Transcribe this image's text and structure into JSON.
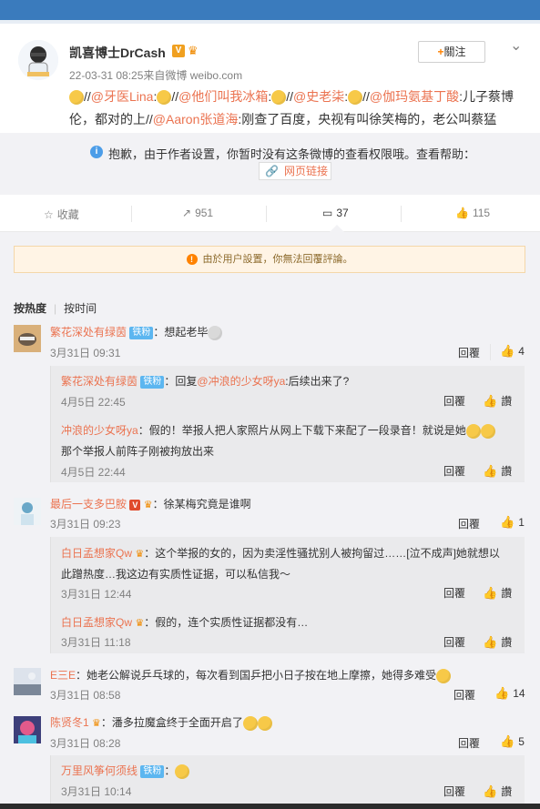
{
  "post": {
    "author": "凯喜博士DrCash",
    "v_badge": "V",
    "date_source": "22-03-31 08:25来自微博 weibo.com",
    "follow_label": "關注",
    "content": {
      "seg1": "//",
      "mention1": "@牙医Lina",
      "seg2": ":",
      "seg3": "//",
      "mention2": "@他们叫我冰箱",
      "seg4": ":",
      "seg5": "//",
      "mention3": "@史老柒",
      "seg6": ":",
      "seg7": "//",
      "mention4": "@伽玛氨基丁酸",
      "seg8": ":儿子蔡博",
      "seg9": "伦，都对的上//",
      "mention5": "@Aaron张道海",
      "seg10": ":刚查了百度，央视有叫徐笑梅的，老公叫蔡猛"
    },
    "notice": "抱歉，由于作者设置，你暂时没有这条微博的查看权限哦。查看帮助：",
    "web_link": "网页链接"
  },
  "actions": {
    "favorite": "收藏",
    "repost": "951",
    "comment": "37",
    "like": "115"
  },
  "comments_area": {
    "warning": "由於用户設置，你無法回覆評論。",
    "sort_hot": "按热度",
    "sort_time": "按时间",
    "reply_label": "回覆",
    "like_label": "讚",
    "fan_badge": "铁粉"
  },
  "comments": [
    {
      "user": "繁花深处有绿茵",
      "text": "想起老毕",
      "time": "3月31日 09:31",
      "likes": "4"
    },
    {
      "user": "最后一支多巴胺",
      "text": "徐某梅究竟是谁啊",
      "time": "3月31日 09:23",
      "likes": "1"
    },
    {
      "user": "E三E",
      "text": "她老公解说乒乓球的，每次看到国乒把小日子按在地上摩擦，她得多难受",
      "time": "3月31日 08:58",
      "likes": "14"
    },
    {
      "user": "陈贤冬1",
      "text": "潘多拉魔盒终于全面开启了",
      "time": "3月31日 08:28",
      "likes": "5"
    }
  ],
  "subs": [
    {
      "user": "繁花深处有绿茵",
      "pre": "回复",
      "mention": "@冲浪的少女呀ya",
      "text": ":后续出来了?",
      "time": "4月5日 22:45"
    },
    {
      "user": "冲浪的少女呀ya",
      "text": "假的！举报人把人家照片从网上下载下来配了一段录音！就说是她",
      "text2": "那个举报人前阵子刚被拘放出来",
      "time": "4月5日 22:44"
    },
    {
      "user": "白日孟想家Qw",
      "text": "这个举报的女的，因为卖淫性骚扰别人被拘留过……[泣不成声]她就想以",
      "text2": "此蹭热度…我这边有实质性证据，可以私信我～",
      "time": "3月31日 12:44"
    },
    {
      "user": "白日孟想家Qw",
      "text": "假的，连个实质性证据都没有…",
      "time": "3月31日 11:18"
    },
    {
      "user": "万里风筝何须线",
      "text": "",
      "time": "3月31日 10:14"
    }
  ]
}
